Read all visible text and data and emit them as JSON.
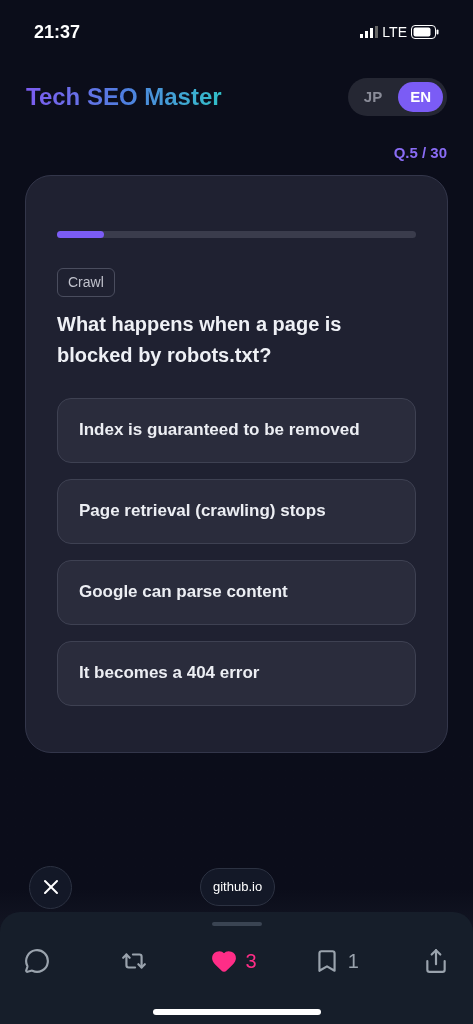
{
  "status_bar": {
    "time": "21:37",
    "network": "LTE"
  },
  "header": {
    "title": "Tech SEO Master",
    "languages": [
      {
        "label": "JP",
        "selected": false
      },
      {
        "label": "EN",
        "selected": true
      }
    ]
  },
  "counter": "Q.5 / 30",
  "quiz": {
    "progress": {
      "level": 0.13
    },
    "tag": "Crawl",
    "question": "What happens when a page is blocked by robots.txt?",
    "options": [
      {
        "label": "Index is guaranteed to be removed"
      },
      {
        "label": "Page retrieval (crawling) stops"
      },
      {
        "label": "Google can parse content"
      },
      {
        "label": "It becomes a 404 error"
      }
    ]
  },
  "browser_bar": {
    "domain": "github.io"
  },
  "actions": [
    {
      "kind": "reply"
    },
    {
      "kind": "repost"
    },
    {
      "kind": "like",
      "count": "3",
      "on": true
    },
    {
      "kind": "bookmark",
      "count": "1",
      "on": false
    },
    {
      "kind": "share"
    }
  ]
}
